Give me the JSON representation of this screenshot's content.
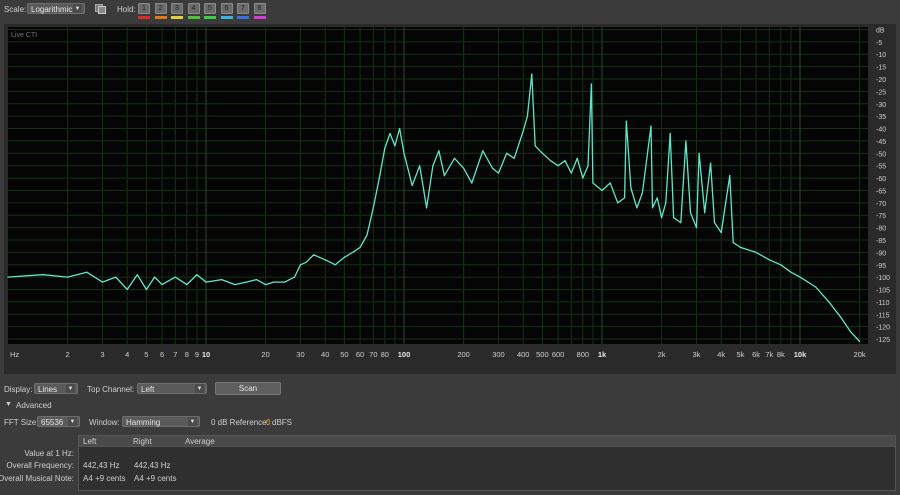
{
  "toolbar": {
    "scale_label": "Scale:",
    "scale_value": "Logarithmic",
    "hold_label": "Hold:",
    "hold_buttons": [
      {
        "label": "1",
        "color": "#d92c2c"
      },
      {
        "label": "2",
        "color": "#e07a1a"
      },
      {
        "label": "3",
        "color": "#e2d23a"
      },
      {
        "label": "4",
        "color": "#4fc43a"
      },
      {
        "label": "5",
        "color": "#3ad04a"
      },
      {
        "label": "6",
        "color": "#38b8e0"
      },
      {
        "label": "7",
        "color": "#3a6fe0"
      },
      {
        "label": "8",
        "color": "#d83ad8"
      }
    ]
  },
  "spectrum": {
    "overlay_label": "Live CTI",
    "trace_color": "#5fe6c8",
    "x_tick_labels": [
      "Hz",
      "2",
      "3",
      "4",
      "5",
      "6",
      "7",
      "8",
      "9",
      "10",
      "20",
      "30",
      "40",
      "50",
      "60",
      "70",
      "80",
      "100",
      "200",
      "300",
      "400",
      "500",
      "600",
      "800",
      "1k",
      "2k",
      "3k",
      "4k",
      "5k",
      "6k",
      "7k",
      "8k",
      "10k",
      "20k"
    ],
    "y_tick_labels": [
      "dB",
      "-5",
      "-10",
      "-15",
      "-20",
      "-25",
      "-30",
      "-35",
      "-40",
      "-45",
      "-50",
      "-55",
      "-60",
      "-65",
      "-70",
      "-75",
      "-80",
      "-85",
      "-90",
      "-95",
      "-100",
      "-105",
      "-110",
      "-115",
      "-120",
      "-125"
    ]
  },
  "chart_data": {
    "type": "line",
    "xscale": "log",
    "xlim": [
      1,
      22050
    ],
    "ylim": [
      -127,
      1
    ],
    "xlabel": "Hz",
    "ylabel": "dB",
    "series": [
      {
        "x": [
          1,
          1.5,
          2,
          2.5,
          3,
          3.5,
          4,
          4.5,
          5,
          5.5,
          6,
          7,
          8,
          9,
          10,
          12,
          14,
          16,
          18,
          20,
          22,
          25,
          28,
          30,
          32,
          35,
          40,
          45,
          50,
          55,
          60,
          65,
          70,
          75,
          80,
          85,
          90,
          95,
          100,
          110,
          120,
          130,
          140,
          150,
          160,
          180,
          200,
          220,
          250,
          280,
          300,
          330,
          360,
          400,
          420,
          442,
          460,
          500,
          550,
          600,
          650,
          700,
          750,
          800,
          850,
          884,
          900,
          1000,
          1100,
          1200,
          1300,
          1326,
          1400,
          1500,
          1600,
          1768,
          1800,
          1900,
          2000,
          2100,
          2210,
          2300,
          2500,
          2652,
          2800,
          3000,
          3094,
          3300,
          3536,
          3700,
          4000,
          4420,
          4600,
          5000,
          6000,
          7000,
          8000,
          9000,
          10000,
          12000,
          14000,
          16000,
          18000,
          20000
        ],
        "y": [
          -100,
          -99,
          -100,
          -98,
          -102,
          -100,
          -105,
          -99,
          -105,
          -100,
          -103,
          -100,
          -103,
          -99,
          -102,
          -101,
          -103,
          -102,
          -101,
          -103,
          -102,
          -102,
          -100,
          -95,
          -94,
          -91,
          -93,
          -95,
          -92,
          -90,
          -88,
          -83,
          -72,
          -60,
          -48,
          -42,
          -47,
          -40,
          -50,
          -63,
          -55,
          -72,
          -55,
          -49,
          -59,
          -52,
          -56,
          -62,
          -49,
          -56,
          -58,
          -50,
          -52,
          -41,
          -35,
          -18,
          -47,
          -50,
          -53,
          -55,
          -53,
          -58,
          -52,
          -60,
          -55,
          -22,
          -62,
          -65,
          -62,
          -70,
          -68,
          -37,
          -64,
          -72,
          -66,
          -39,
          -72,
          -68,
          -76,
          -70,
          -42,
          -76,
          -78,
          -45,
          -74,
          -80,
          -50,
          -74,
          -54,
          -78,
          -82,
          -59,
          -86,
          -88,
          -90,
          -93,
          -95,
          -98,
          -100,
          -104,
          -110,
          -116,
          -122,
          -126
        ]
      }
    ]
  },
  "controls": {
    "display_label": "Display:",
    "display_value": "Lines",
    "top_channel_label": "Top Channel:",
    "top_channel_value": "Left",
    "scan_label": "Scan",
    "advanced_label": "Advanced",
    "fft_label": "FFT Size:",
    "fft_value": "65536",
    "window_label": "Window:",
    "window_value": "Hamming",
    "zero_db_label": "0 dB Reference:",
    "zero_db_value": "0",
    "zero_db_unit": "dBFS"
  },
  "table": {
    "headers": [
      "Left",
      "Right",
      "Average"
    ],
    "row_labels": [
      "Value at 1 Hz:",
      "Overall Frequency:",
      "Overall Musical Note:"
    ],
    "frequency_left": "442,43 Hz",
    "frequency_right": "442,43 Hz",
    "note_left": "A4 +9 cents",
    "note_right": "A4 +9 cents"
  }
}
